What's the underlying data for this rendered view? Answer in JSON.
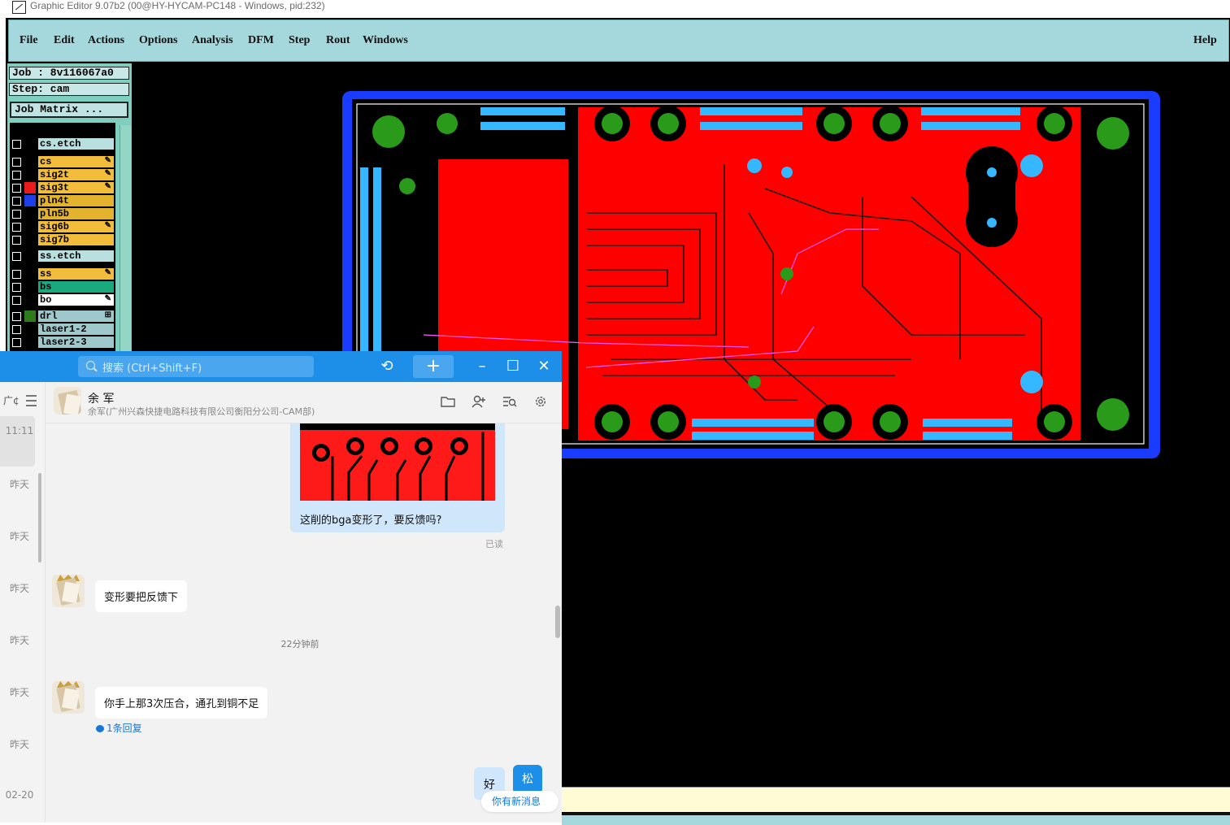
{
  "window": {
    "title": "Graphic Editor 9.07b2 (00@HY-HYCAM-PC148 - Windows, pid:232)"
  },
  "menu": {
    "items": [
      "File",
      "Edit",
      "Actions",
      "Options",
      "Analysis",
      "DFM",
      "Step",
      "Rout",
      "Windows"
    ],
    "help": "Help"
  },
  "job": {
    "job_line": "Job : 8v116067a0",
    "step_line": "Step: cam",
    "matrix_button": "Job Matrix ..."
  },
  "layers": [
    {
      "name": "cs.etch",
      "swatch": "#000000",
      "bg": "#b9dfdf",
      "mark": ""
    },
    {
      "name": "cs",
      "swatch": "#000000",
      "bg": "#f2bd3a",
      "mark": "✎"
    },
    {
      "name": "sig2t",
      "swatch": "#000000",
      "bg": "#f2bd3a",
      "mark": "✎"
    },
    {
      "name": "sig3t",
      "swatch": "#e81c1c",
      "bg": "#f2bd3a",
      "mark": "✎"
    },
    {
      "name": "pln4t",
      "swatch": "#1f3fe8",
      "bg": "#e3b32e",
      "mark": ""
    },
    {
      "name": "pln5b",
      "swatch": "#000000",
      "bg": "#e3b32e",
      "mark": ""
    },
    {
      "name": "sig6b",
      "swatch": "#000000",
      "bg": "#f2bd3a",
      "mark": "✎"
    },
    {
      "name": "sig7b",
      "swatch": "#000000",
      "bg": "#f2bd3a",
      "mark": ""
    },
    {
      "name": "ss.etch",
      "swatch": "#000000",
      "bg": "#b9dfdf",
      "mark": ""
    },
    {
      "name": "ss",
      "swatch": "#000000",
      "bg": "#f2bd3a",
      "mark": "✎"
    },
    {
      "name": "bs",
      "swatch": "#000000",
      "bg": "#1aa87f",
      "mark": ""
    },
    {
      "name": "bo",
      "swatch": "#000000",
      "bg": "#ffffff",
      "mark": "✎"
    },
    {
      "name": "drl",
      "swatch": "#2f7a1a",
      "bg": "#9fc8cc",
      "mark": "⊞"
    },
    {
      "name": "laser1-2",
      "swatch": "#000000",
      "bg": "#9fc8cc",
      "mark": ""
    },
    {
      "name": "laser2-3",
      "swatch": "#000000",
      "bg": "#9fc8cc",
      "mark": ""
    }
  ],
  "colors": {
    "copper": "#ff0000",
    "outline": "#1a3cff",
    "pad_green": "#2a9a1a",
    "pad_cyan": "#35b8ff",
    "accent": "#1d8fe8"
  },
  "chat": {
    "search_placeholder": "搜索 (Ctrl+Shift+F)",
    "list_header": "广¢",
    "session_times": [
      "11:11",
      "昨天",
      "昨天",
      "昨天",
      "昨天",
      "昨天",
      "昨天",
      "02-20"
    ],
    "contact_name": "余 军",
    "contact_sub": "余军(广州兴森快捷电路科技有限公司衡阳分公司-CAM部)",
    "messages": {
      "image_caption": "这削的bga变形了，要反馈吗?",
      "read": "已读",
      "reply1": "变形要把反馈下",
      "time_sep": "22分钟前",
      "reply2": "你手上那3次压合，通孔到铜不足",
      "reply_count": "1条回复",
      "mine": "好",
      "my_avatar": "松",
      "new_msg": "你有新消息"
    }
  }
}
